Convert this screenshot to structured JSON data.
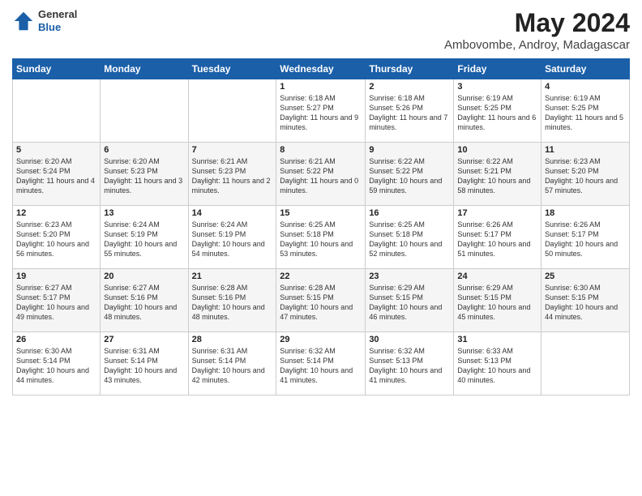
{
  "header": {
    "logo": {
      "line1": "General",
      "line2": "Blue"
    },
    "month_title": "May 2024",
    "location": "Ambovombe, Androy, Madagascar"
  },
  "calendar": {
    "headers": [
      "Sunday",
      "Monday",
      "Tuesday",
      "Wednesday",
      "Thursday",
      "Friday",
      "Saturday"
    ],
    "weeks": [
      [
        {
          "day": "",
          "info": ""
        },
        {
          "day": "",
          "info": ""
        },
        {
          "day": "",
          "info": ""
        },
        {
          "day": "1",
          "info": "Sunrise: 6:18 AM\nSunset: 5:27 PM\nDaylight: 11 hours\nand 9 minutes."
        },
        {
          "day": "2",
          "info": "Sunrise: 6:18 AM\nSunset: 5:26 PM\nDaylight: 11 hours\nand 7 minutes."
        },
        {
          "day": "3",
          "info": "Sunrise: 6:19 AM\nSunset: 5:25 PM\nDaylight: 11 hours\nand 6 minutes."
        },
        {
          "day": "4",
          "info": "Sunrise: 6:19 AM\nSunset: 5:25 PM\nDaylight: 11 hours\nand 5 minutes."
        }
      ],
      [
        {
          "day": "5",
          "info": "Sunrise: 6:20 AM\nSunset: 5:24 PM\nDaylight: 11 hours\nand 4 minutes."
        },
        {
          "day": "6",
          "info": "Sunrise: 6:20 AM\nSunset: 5:23 PM\nDaylight: 11 hours\nand 3 minutes."
        },
        {
          "day": "7",
          "info": "Sunrise: 6:21 AM\nSunset: 5:23 PM\nDaylight: 11 hours\nand 2 minutes."
        },
        {
          "day": "8",
          "info": "Sunrise: 6:21 AM\nSunset: 5:22 PM\nDaylight: 11 hours\nand 0 minutes."
        },
        {
          "day": "9",
          "info": "Sunrise: 6:22 AM\nSunset: 5:22 PM\nDaylight: 10 hours\nand 59 minutes."
        },
        {
          "day": "10",
          "info": "Sunrise: 6:22 AM\nSunset: 5:21 PM\nDaylight: 10 hours\nand 58 minutes."
        },
        {
          "day": "11",
          "info": "Sunrise: 6:23 AM\nSunset: 5:20 PM\nDaylight: 10 hours\nand 57 minutes."
        }
      ],
      [
        {
          "day": "12",
          "info": "Sunrise: 6:23 AM\nSunset: 5:20 PM\nDaylight: 10 hours\nand 56 minutes."
        },
        {
          "day": "13",
          "info": "Sunrise: 6:24 AM\nSunset: 5:19 PM\nDaylight: 10 hours\nand 55 minutes."
        },
        {
          "day": "14",
          "info": "Sunrise: 6:24 AM\nSunset: 5:19 PM\nDaylight: 10 hours\nand 54 minutes."
        },
        {
          "day": "15",
          "info": "Sunrise: 6:25 AM\nSunset: 5:18 PM\nDaylight: 10 hours\nand 53 minutes."
        },
        {
          "day": "16",
          "info": "Sunrise: 6:25 AM\nSunset: 5:18 PM\nDaylight: 10 hours\nand 52 minutes."
        },
        {
          "day": "17",
          "info": "Sunrise: 6:26 AM\nSunset: 5:17 PM\nDaylight: 10 hours\nand 51 minutes."
        },
        {
          "day": "18",
          "info": "Sunrise: 6:26 AM\nSunset: 5:17 PM\nDaylight: 10 hours\nand 50 minutes."
        }
      ],
      [
        {
          "day": "19",
          "info": "Sunrise: 6:27 AM\nSunset: 5:17 PM\nDaylight: 10 hours\nand 49 minutes."
        },
        {
          "day": "20",
          "info": "Sunrise: 6:27 AM\nSunset: 5:16 PM\nDaylight: 10 hours\nand 48 minutes."
        },
        {
          "day": "21",
          "info": "Sunrise: 6:28 AM\nSunset: 5:16 PM\nDaylight: 10 hours\nand 48 minutes."
        },
        {
          "day": "22",
          "info": "Sunrise: 6:28 AM\nSunset: 5:15 PM\nDaylight: 10 hours\nand 47 minutes."
        },
        {
          "day": "23",
          "info": "Sunrise: 6:29 AM\nSunset: 5:15 PM\nDaylight: 10 hours\nand 46 minutes."
        },
        {
          "day": "24",
          "info": "Sunrise: 6:29 AM\nSunset: 5:15 PM\nDaylight: 10 hours\nand 45 minutes."
        },
        {
          "day": "25",
          "info": "Sunrise: 6:30 AM\nSunset: 5:15 PM\nDaylight: 10 hours\nand 44 minutes."
        }
      ],
      [
        {
          "day": "26",
          "info": "Sunrise: 6:30 AM\nSunset: 5:14 PM\nDaylight: 10 hours\nand 44 minutes."
        },
        {
          "day": "27",
          "info": "Sunrise: 6:31 AM\nSunset: 5:14 PM\nDaylight: 10 hours\nand 43 minutes."
        },
        {
          "day": "28",
          "info": "Sunrise: 6:31 AM\nSunset: 5:14 PM\nDaylight: 10 hours\nand 42 minutes."
        },
        {
          "day": "29",
          "info": "Sunrise: 6:32 AM\nSunset: 5:14 PM\nDaylight: 10 hours\nand 41 minutes."
        },
        {
          "day": "30",
          "info": "Sunrise: 6:32 AM\nSunset: 5:13 PM\nDaylight: 10 hours\nand 41 minutes."
        },
        {
          "day": "31",
          "info": "Sunrise: 6:33 AM\nSunset: 5:13 PM\nDaylight: 10 hours\nand 40 minutes."
        },
        {
          "day": "",
          "info": ""
        }
      ]
    ]
  }
}
